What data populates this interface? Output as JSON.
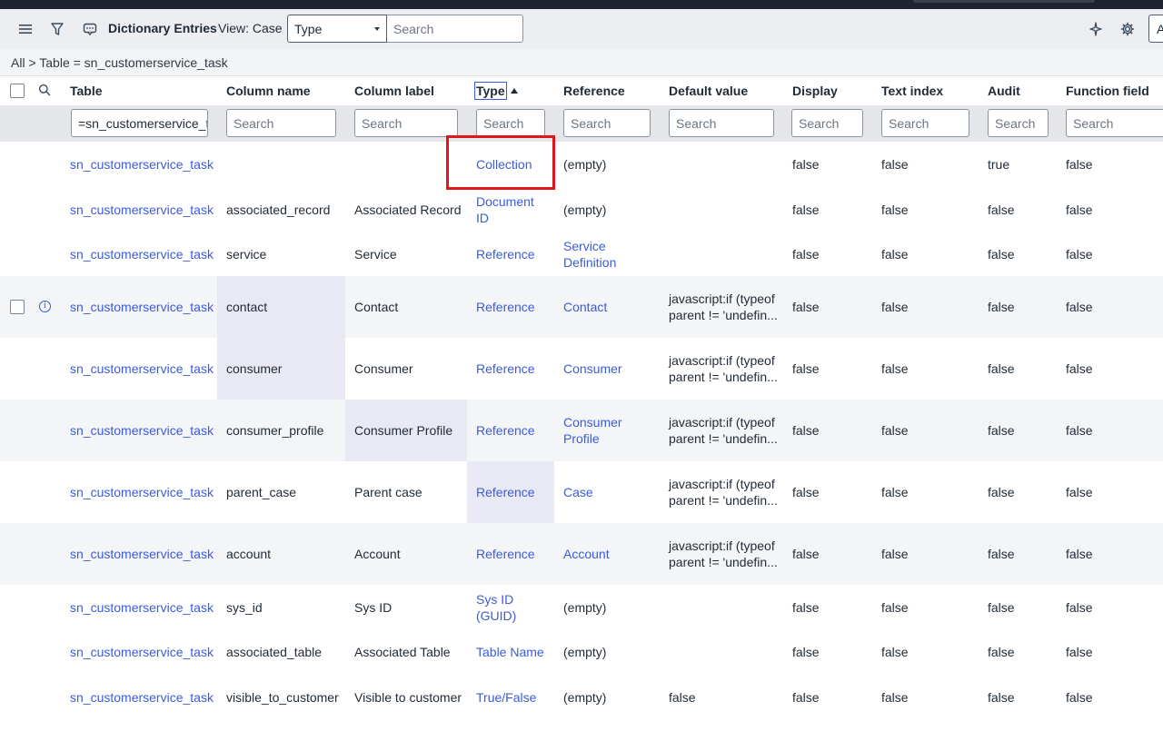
{
  "toolbar": {
    "title": "Dictionary Entries",
    "view_label": "View: Case",
    "field_select": "Type",
    "search_placeholder": "Search",
    "right_button_label": "A"
  },
  "breadcrumb": "All > Table = sn_customerservice_task",
  "columns": [
    "Table",
    "Column name",
    "Column label",
    "Type",
    "Reference",
    "Default value",
    "Display",
    "Text index",
    "Audit",
    "Function field"
  ],
  "filters": {
    "table": "=sn_customerservice_task",
    "placeholder": "Search"
  },
  "rows": [
    {
      "table": "sn_customerservice_task",
      "column_name": "",
      "column_label": "",
      "type": "Collection",
      "reference": "(empty)",
      "default_value": "",
      "display": "false",
      "text_index": "false",
      "audit": "true",
      "function_field": "false"
    },
    {
      "table": "sn_customerservice_task",
      "column_name": "associated_record",
      "column_label": "Associated Record",
      "type": "Document ID",
      "reference": "(empty)",
      "default_value": "",
      "display": "false",
      "text_index": "false",
      "audit": "false",
      "function_field": "false"
    },
    {
      "table": "sn_customerservice_task",
      "column_name": "service",
      "column_label": "Service",
      "type": "Reference",
      "reference": "Service Definition",
      "default_value": "",
      "display": "false",
      "text_index": "false",
      "audit": "false",
      "function_field": "false"
    },
    {
      "table": "sn_customerservice_task",
      "column_name": "contact",
      "column_label": "Contact",
      "type": "Reference",
      "reference": "Contact",
      "default_value": "javascript:if (typeof parent != 'undefin...",
      "display": "false",
      "text_index": "false",
      "audit": "false",
      "function_field": "false"
    },
    {
      "table": "sn_customerservice_task",
      "column_name": "consumer",
      "column_label": "Consumer",
      "type": "Reference",
      "reference": "Consumer",
      "default_value": "javascript:if (typeof parent != 'undefin...",
      "display": "false",
      "text_index": "false",
      "audit": "false",
      "function_field": "false"
    },
    {
      "table": "sn_customerservice_task",
      "column_name": "consumer_profile",
      "column_label": "Consumer Profile",
      "type": "Reference",
      "reference": "Consumer Profile",
      "default_value": "javascript:if (typeof parent != 'undefin...",
      "display": "false",
      "text_index": "false",
      "audit": "false",
      "function_field": "false"
    },
    {
      "table": "sn_customerservice_task",
      "column_name": "parent_case",
      "column_label": "Parent case",
      "type": "Reference",
      "reference": "Case",
      "default_value": "javascript:if (typeof parent != 'undefin...",
      "display": "false",
      "text_index": "false",
      "audit": "false",
      "function_field": "false"
    },
    {
      "table": "sn_customerservice_task",
      "column_name": "account",
      "column_label": "Account",
      "type": "Reference",
      "reference": "Account",
      "default_value": "javascript:if (typeof parent != 'undefin...",
      "display": "false",
      "text_index": "false",
      "audit": "false",
      "function_field": "false"
    },
    {
      "table": "sn_customerservice_task",
      "column_name": "sys_id",
      "column_label": "Sys ID",
      "type": "Sys ID (GUID)",
      "reference": "(empty)",
      "default_value": "",
      "display": "false",
      "text_index": "false",
      "audit": "false",
      "function_field": "false"
    },
    {
      "table": "sn_customerservice_task",
      "column_name": "associated_table",
      "column_label": "Associated Table",
      "type": "Table Name",
      "reference": "(empty)",
      "default_value": "",
      "display": "false",
      "text_index": "false",
      "audit": "false",
      "function_field": "false"
    },
    {
      "table": "sn_customerservice_task",
      "column_name": "visible_to_customer",
      "column_label": "Visible to customer",
      "type": "True/False",
      "reference": "(empty)",
      "default_value": "false",
      "display": "false",
      "text_index": "false",
      "audit": "false",
      "function_field": "false"
    }
  ],
  "colors": {
    "link": "#3b5bdb",
    "highlight_box": "#e0161b",
    "toolbar_bg": "#eceef1"
  }
}
